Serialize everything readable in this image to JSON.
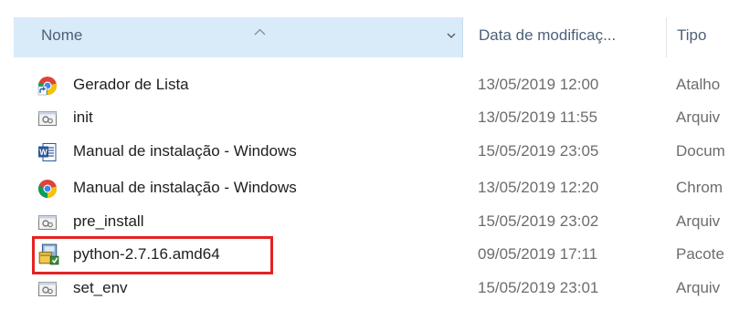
{
  "header": {
    "name_label": "Nome",
    "date_label": "Data de modificaç...",
    "type_label": "Tipo"
  },
  "files": [
    {
      "name": "Gerador de Lista",
      "date": "13/05/2019 12:00",
      "type": "Atalho",
      "icon": "chrome-shortcut-icon"
    },
    {
      "name": "init",
      "date": "13/05/2019 11:55",
      "type": "Arquiv",
      "icon": "batch-file-icon"
    },
    {
      "name": "Manual de instalação - Windows",
      "date": "15/05/2019 23:05",
      "type": "Docum",
      "icon": "word-document-icon"
    },
    {
      "name": "Manual de instalação - Windows",
      "date": "13/05/2019 12:20",
      "type": "Chrom",
      "icon": "chrome-icon"
    },
    {
      "name": "pre_install",
      "date": "15/05/2019 23:02",
      "type": "Arquiv",
      "icon": "batch-file-icon"
    },
    {
      "name": "python-2.7.16.amd64",
      "date": "09/05/2019 17:11",
      "type": "Pacote",
      "icon": "msi-installer-icon"
    },
    {
      "name": "set_env",
      "date": "15/05/2019 23:01",
      "type": "Arquiv",
      "icon": "batch-file-icon"
    }
  ],
  "colors": {
    "header_selected_bg": "#d9ebf9",
    "highlight_border": "#e52222",
    "header_text": "#4c607a",
    "secondary_text": "#6d6d6d"
  }
}
